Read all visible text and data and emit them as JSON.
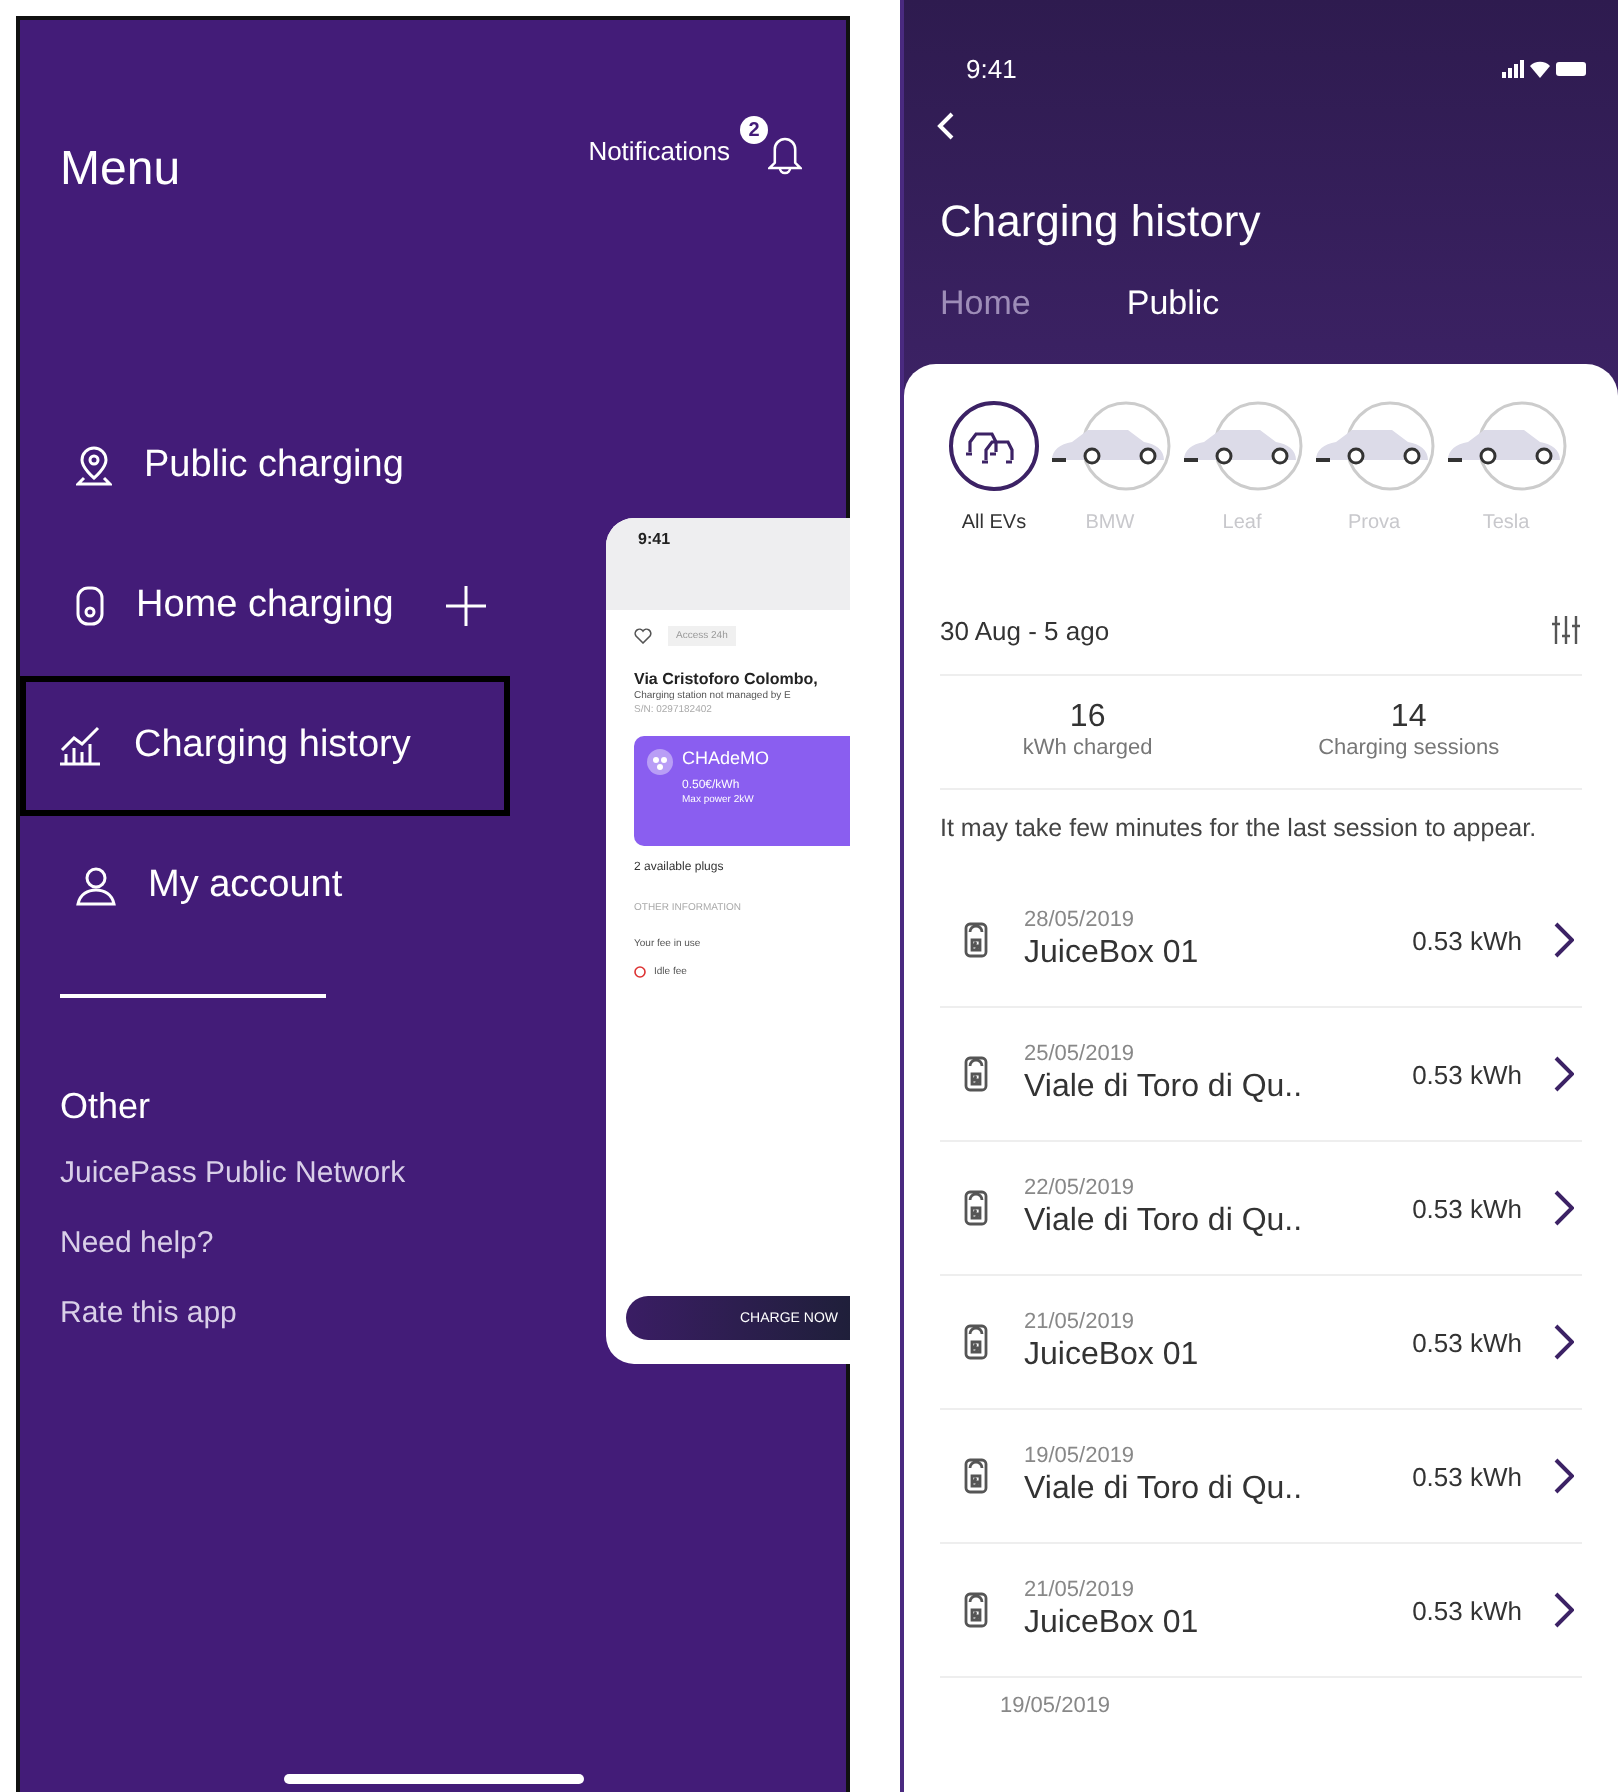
{
  "menu": {
    "title": "Menu",
    "notifications": {
      "label": "Notifications",
      "count": "2"
    },
    "items": [
      {
        "kind": "pin",
        "label": "Public charging",
        "selected": false,
        "add": false
      },
      {
        "kind": "plug",
        "label": "Home charging",
        "selected": false,
        "add": true
      },
      {
        "kind": "chart",
        "label": "Charging history",
        "selected": true,
        "add": false
      },
      {
        "kind": "person",
        "label": "My account",
        "selected": false,
        "add": false
      }
    ],
    "other_title": "Other",
    "links": [
      "JuicePass Public Network",
      "Need help?",
      "Rate this app"
    ]
  },
  "preview": {
    "time": "9:41",
    "tag": "Access 24h",
    "title": "Via Cristoforo Colombo,",
    "subtitle": "Charging station not managed by E",
    "serial": "S/N: 0297182402",
    "plug": {
      "name": "CHAdeMO",
      "price": "0.50€/kWh",
      "power": "Max power 2kW"
    },
    "available": "2 available plugs",
    "section": "OTHER INFORMATION",
    "fee": "Your fee in use",
    "idle": "Idle fee",
    "button": "CHARGE NOW"
  },
  "history": {
    "time": "9:41",
    "title": "Charging history",
    "tabs": [
      {
        "label": "Home",
        "selected": false
      },
      {
        "label": "Public",
        "selected": true
      }
    ],
    "evs": [
      {
        "kind": "all",
        "label": "All EVs",
        "selected": true
      },
      {
        "kind": "car",
        "label": "BMW",
        "selected": false
      },
      {
        "kind": "car",
        "label": "Leaf",
        "selected": false
      },
      {
        "kind": "car",
        "label": "Prova",
        "selected": false
      },
      {
        "kind": "car",
        "label": "Tesla",
        "selected": false
      }
    ],
    "range": "30 Aug - 5 ago",
    "stats": [
      {
        "value": "16",
        "label": "kWh charged"
      },
      {
        "value": "14",
        "label": "Charging sessions"
      }
    ],
    "note": "It may take few minutes for the last session to appear.",
    "sessions": [
      {
        "date": "28/05/2019",
        "name": "JuiceBox 01",
        "energy": "0.53 kWh"
      },
      {
        "date": "25/05/2019",
        "name": "Viale di Toro di Qu..",
        "energy": "0.53 kWh"
      },
      {
        "date": "22/05/2019",
        "name": "Viale di Toro di Qu..",
        "energy": "0.53 kWh"
      },
      {
        "date": "21/05/2019",
        "name": "JuiceBox 01",
        "energy": "0.53 kWh"
      },
      {
        "date": "19/05/2019",
        "name": "Viale di Toro di Qu..",
        "energy": "0.53 kWh"
      },
      {
        "date": "21/05/2019",
        "name": "JuiceBox 01",
        "energy": "0.53 kWh"
      },
      {
        "date": "19/05/2019"
      }
    ]
  }
}
